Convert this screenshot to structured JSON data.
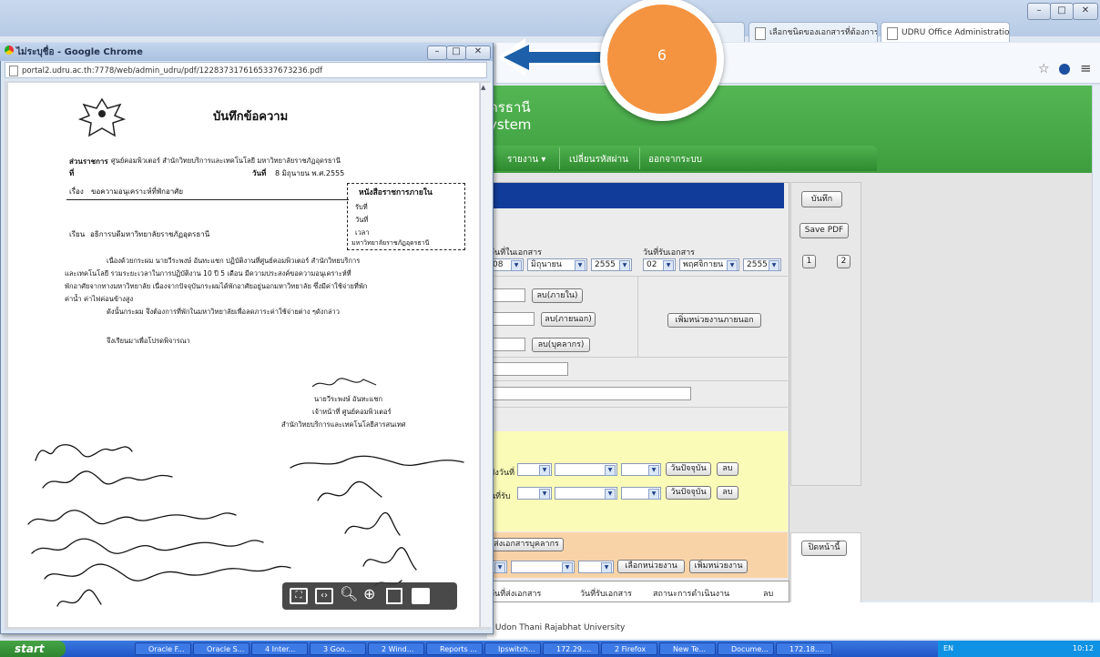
{
  "browser": {
    "tabs": [
      {
        "label": "d"
      },
      {
        "label": "เลือกชนิดของเอกสารที่ต้องการ"
      },
      {
        "label": "UDRU Office Administration"
      }
    ],
    "window_controls": {
      "minimize": "–",
      "maximize": "□",
      "close": "✕"
    },
    "toolbar_icons": {
      "star": "☆",
      "menu": "≡"
    }
  },
  "app": {
    "title_line1": "ดรธานี",
    "title_line2": "ystem",
    "menu": [
      "รายงาน ▾",
      "เปลี่ยนรหัสผ่าน",
      "ออกจากระบบ"
    ],
    "fields": {
      "doc_date_label": "วันที่ในเอกสาร",
      "doc_date": {
        "day": "08",
        "month": "มิถุนายน",
        "year": "2555"
      },
      "recv_date_label": "วันที่รับเอกสาร",
      "recv_date": {
        "day": "02",
        "month": "พฤศจิกายน",
        "year": "2555"
      },
      "btn_del_internal": "ลบ(ภายใน)",
      "btn_del_external": "ลบ(ภายนอก)",
      "btn_add_external_unit": "เพิ่มหน่วยงานภายนอก",
      "btn_del_personnel": "ลบ(บุคลากร)",
      "send_date_label": "ส่งวันที่",
      "recv_label": "นที่รับ",
      "btn_today": "วันปัจจุบัน",
      "btn_del": "ลบ",
      "btn_send_personnel": "ส่งเอกสารบุคลากร",
      "btn_select_unit": "เลือกหน่วยงาน",
      "btn_add_unit": "เพิ่มหน่วยงาน",
      "col_send_date": "วันที่ส่งเอกสาร",
      "col_recv_date": "วันที่รับเอกสาร",
      "col_status": "สถานะการดำเนินงาน",
      "col_del": "ลบ"
    },
    "side": {
      "save": "บันทึก",
      "save_pdf": "Save PDF",
      "page1": "1",
      "page2": "2",
      "close_page": "ปิดหน้านี้"
    },
    "footer": ": Udon Thani Rajabhat University"
  },
  "popup": {
    "title": "ไม่ระบุชื่อ - Google Chrome",
    "url": "portal2.udru.ac.th:7778/web/admin_udru/pdf/12283731761653376732​36.pdf",
    "doc": {
      "heading": "บันทึกข้อความ",
      "dept_label": "ส่วนราชการ",
      "dept": "ศูนย์คอมพิวเตอร์ สำนักวิทยบริการและเทคโนโลยี มหาวิทยาลัยราชภัฏอุดรธานี",
      "no_label": "ที่",
      "date_label": "วันที่",
      "date": "8 มิถุนายน   พ.ศ.2555",
      "subject_label": "เรื่อง",
      "subject": "ขอความอนุเคราะห์ที่พักอาศัย",
      "stamp_title": "หนังสือราชการภายใน",
      "stamp_no": "รับที่",
      "stamp_date": "วันที่",
      "stamp_time": "เวลา",
      "stamp_org": "มหาวิทยาลัยราชภัฏอุดรธานี",
      "to_label": "เรียน",
      "to": "อธิการบดีมหาวิทยาลัยราชภัฏอุดรธานี",
      "body1": "เนื่องด้วยกระผม นายวีระพงษ์ อันทะแชก ปฏิบัติงานที่ศูนย์คอมพิวเตอร์ สำนักวิทยบริการ",
      "body2": "และเทคโนโลยี รวมระยะเวลาในการปฏิบัติงาน  10  ปี  5      เดือน มีความประสงค์ขอความอนุเคราะห์ที่",
      "body3": "พักอาศัยจากทางมหาวิทยาลัย  เนื่องจากปัจจุบันกระผมได้พักอาศัยอยู่นอกมหาวิทยาลัย  ซึ่งมีค่าใช้จ่ายที่พัก",
      "body4": "ค่าน้ำ ค่าไฟค่อนข้างสูง",
      "body5": "ดังนั้นกระผม จึงต้องการที่พักในมหาวิทยาลัยเพื่อลดภาระค่าใช้จ่ายต่าง ๆดังกล่าว",
      "body6": "จึงเรียนมาเพื่อโปรดพิจารณา",
      "sign_name": "นายวีระพงษ์ อันทะแชก",
      "sign_pos": "เจ้าหน้าที่ ศูนย์คอมพิวเตอร์",
      "sign_org": "สำนักวิทยบริการและเทคโนโลยีสารสนเทศ"
    }
  },
  "overlay": {
    "step_number": "6"
  },
  "taskbar": {
    "start": "start",
    "items": [
      "Oracle F...",
      "Oracle S...",
      "4 Inter...",
      "3 Goo...",
      "2 Wind...",
      "Reports ...",
      "Ipswitch...",
      "172.29....",
      "2 Firefox",
      "New Te...",
      "Docume...",
      "172.18...."
    ],
    "lang": "EN",
    "clock": "10:12"
  },
  "colors": {
    "green": "#3e9e3e",
    "navy": "#123c9a",
    "orange": "#f49340",
    "arrow": "#1d5fa8",
    "yellow": "#fbfbb8",
    "peach": "#f9d3a8"
  }
}
